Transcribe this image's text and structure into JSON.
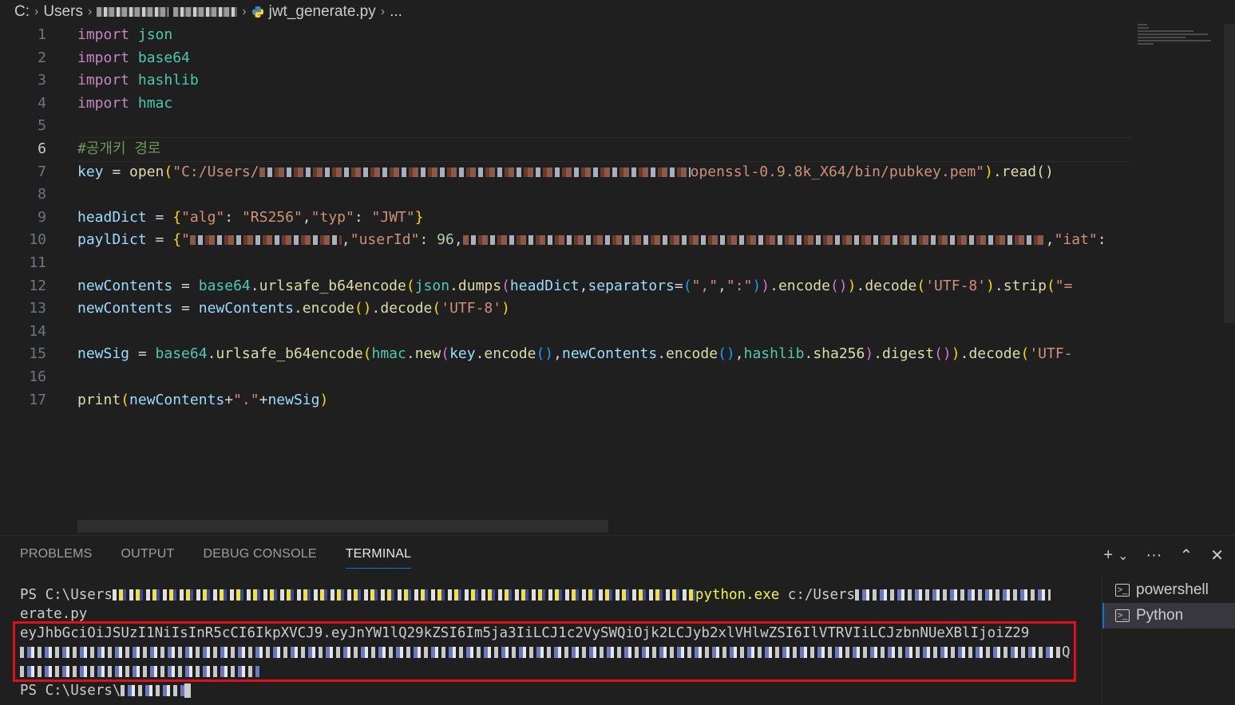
{
  "breadcrumb": {
    "drive": "C:",
    "users": "Users",
    "file": "jwt_generate.py",
    "ellipsis": "..."
  },
  "editor": {
    "line_numbers": [
      "1",
      "2",
      "3",
      "4",
      "5",
      "6",
      "7",
      "8",
      "9",
      "10",
      "11",
      "12",
      "13",
      "14",
      "15",
      "16",
      "17"
    ],
    "active_line": "6",
    "line1": {
      "kw": "import",
      "mod": "json"
    },
    "line2": {
      "kw": "import",
      "mod": "base64"
    },
    "line3": {
      "kw": "import",
      "mod": "hashlib"
    },
    "line4": {
      "kw": "import",
      "mod": "hmac"
    },
    "line6": {
      "comment": "#공개키 경로"
    },
    "line7": {
      "var": "key",
      "op": " = ",
      "fn": "open",
      "str_a": "\"C:/Users/",
      "str_b": "openssl-0.9.8k_X64/bin/pubkey.pem\"",
      "tail": ".read()"
    },
    "line9": {
      "var": "headDict",
      "op": " = ",
      "k1": "\"alg\"",
      "v1": "\"RS256\"",
      "k2": "\"typ\"",
      "v2": "\"JWT\""
    },
    "line10": {
      "var": "paylDict",
      "op": " = ",
      "k_user": "\"userId\"",
      "v_user": "96",
      "k_iat": "\"iat\""
    },
    "line12": {
      "var": "newContents",
      "mod1": "base64",
      "fn1": "urlsafe_b64encode",
      "mod2": "json",
      "fn2": "dumps",
      "arg": "headDict",
      "kwarg": "separators",
      "s1": "\",\"",
      "s2": "\":\"",
      "fn3": "encode",
      "fn4": "decode",
      "s3": "'UTF-8'",
      "fn5": "strip",
      "s4": "\"="
    },
    "line13": {
      "var": "newContents",
      "obj": "newContents",
      "fn1": "encode",
      "fn2": "decode",
      "s1": "'UTF-8'"
    },
    "line15": {
      "var": "newSig",
      "mod1": "base64",
      "fn1": "urlsafe_b64encode",
      "mod2": "hmac",
      "fn2": "new",
      "a1": "key",
      "fn3": "encode",
      "a2": "newContents",
      "fn4": "encode",
      "mod3": "hashlib",
      "a3": "sha256",
      "fn5": "digest",
      "fn6": "decode",
      "s1": "'UTF-"
    },
    "line17": {
      "fn": "print",
      "a1": "newContents",
      "s1": "\".\"",
      "a2": "newSig"
    }
  },
  "panel": {
    "tabs": [
      "PROBLEMS",
      "OUTPUT",
      "DEBUG CONSOLE",
      "TERMINAL"
    ],
    "active_tab": "TERMINAL",
    "actions": {
      "add": "+",
      "dropdown": "⌄",
      "more": "···",
      "maximize": "⌃",
      "close": "✕"
    },
    "terminal": {
      "line1_prompt": "PS C:\\Users",
      "line1_exe": "python.exe",
      "line1_path": " c:/Users",
      "line2": "erate.py",
      "line3": "eyJhbGciOiJSUzI1NiIsInR5cCI6IkpXVCJ9.eyJnYW1lQ29kZSI6Im5ja3IiLCJ1c2VySWQiOjk2LCJyb2xlVHlwZSI6IlVTRVIiLCJzbnNUeXBlIjoiZ29",
      "line4_end": "Q",
      "line6_prompt": "PS C:\\Users\\"
    },
    "terminal_list": [
      {
        "label": "powershell",
        "active": false
      },
      {
        "label": "Python",
        "active": true
      }
    ]
  },
  "colors": {
    "background": "#1f1f1f",
    "highlight_box": "#e0101a",
    "accent": "#0078d4"
  }
}
